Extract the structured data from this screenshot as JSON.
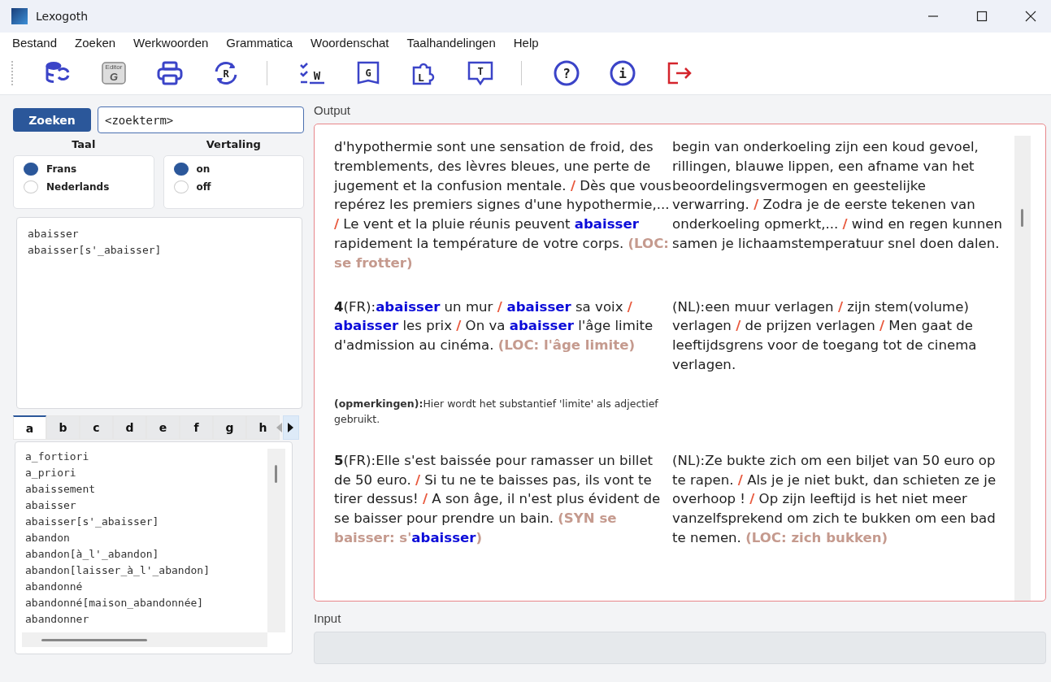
{
  "window": {
    "title": "Lexogoth"
  },
  "menu": [
    "Bestand",
    "Zoeken",
    "Werkwoorden",
    "Grammatica",
    "Woordenschat",
    "Taalhandelingen",
    "Help"
  ],
  "toolbar": [
    {
      "kind": "database-sync"
    },
    {
      "kind": "editor",
      "label": "Editor",
      "letter": "G"
    },
    {
      "kind": "printer"
    },
    {
      "kind": "refresh",
      "letter": "R"
    },
    {
      "kind": "separator"
    },
    {
      "kind": "checklist",
      "letter": "W"
    },
    {
      "kind": "book",
      "letter": "G"
    },
    {
      "kind": "puzzle",
      "letter": "L"
    },
    {
      "kind": "speech",
      "letter": "T"
    },
    {
      "kind": "separator"
    },
    {
      "kind": "circle",
      "letter": "?"
    },
    {
      "kind": "circle",
      "letter": "i"
    },
    {
      "kind": "exit"
    }
  ],
  "search": {
    "button": "Zoeken",
    "value": "<zoekterm>"
  },
  "taal": {
    "label": "Taal",
    "options": [
      {
        "label": "Frans",
        "selected": true
      },
      {
        "label": "Nederlands",
        "selected": false
      }
    ]
  },
  "vertaling": {
    "label": "Vertaling",
    "options": [
      {
        "label": "on",
        "selected": true
      },
      {
        "label": "off",
        "selected": false
      }
    ]
  },
  "results": [
    "abaisser",
    "abaisser[s'_abaisser]"
  ],
  "letter_tabs": [
    {
      "label": "a",
      "selected": true
    },
    {
      "label": "b",
      "selected": false
    },
    {
      "label": "c",
      "selected": false
    },
    {
      "label": "d",
      "selected": false
    },
    {
      "label": "e",
      "selected": false
    },
    {
      "label": "f",
      "selected": false
    },
    {
      "label": "g",
      "selected": false
    },
    {
      "label": "h",
      "selected": false
    }
  ],
  "word_list": [
    "a_fortiori",
    "a_priori",
    "abaissement",
    "abaisser",
    "abaisser[s'_abaisser]",
    "abandon",
    "abandon[à_l'_abandon]",
    "abandon[laisser_à_l'_abandon]",
    "abandonné",
    "abandonné[maison_abandonnée]",
    "abandonner"
  ],
  "output": {
    "label": "Output",
    "entries": [
      {
        "fr": [
          {
            "kind": "text",
            "text": "d'hypothermie sont une sensation de froid, des tremblements, des lèvres bleues, une perte de jugement et la confusion mentale. "
          },
          {
            "kind": "sep",
            "text": "/"
          },
          {
            "kind": "text",
            "text": " Dès que vous repérez les premiers signes d'une hypothermie,... "
          },
          {
            "kind": "sep",
            "text": "/"
          },
          {
            "kind": "text",
            "text": " Le vent et la pluie réunis peuvent "
          },
          {
            "kind": "hit",
            "text": "abaisser"
          },
          {
            "kind": "text",
            "text": " rapidement la température de votre corps. "
          },
          {
            "kind": "loc",
            "text": "(LOC: se frotter)"
          }
        ],
        "nl": [
          {
            "kind": "text",
            "text": "begin van onderkoeling zijn een koud gevoel, rillingen, blauwe lippen, een afname van het beoordelingsvermogen en geestelijke verwarring. "
          },
          {
            "kind": "sep",
            "text": "/"
          },
          {
            "kind": "text",
            "text": " Zodra je de eerste tekenen van onderkoeling opmerkt,... "
          },
          {
            "kind": "sep",
            "text": "/"
          },
          {
            "kind": "text",
            "text": " wind en regen kunnen samen je lichaamstemperatuur snel doen dalen."
          }
        ]
      },
      {
        "fr": [
          {
            "kind": "num",
            "text": "4"
          },
          {
            "kind": "text",
            "text": "(FR):"
          },
          {
            "kind": "hit",
            "text": "abaisser"
          },
          {
            "kind": "text",
            "text": " un mur "
          },
          {
            "kind": "sep",
            "text": "/ "
          },
          {
            "kind": "hit",
            "text": "abaisser"
          },
          {
            "kind": "text",
            "text": " sa voix "
          },
          {
            "kind": "sep",
            "text": "/ "
          },
          {
            "kind": "hit",
            "text": "abaisser"
          },
          {
            "kind": "text",
            "text": " les prix "
          },
          {
            "kind": "sep",
            "text": "/"
          },
          {
            "kind": "text",
            "text": " On va "
          },
          {
            "kind": "hit",
            "text": "abaisser"
          },
          {
            "kind": "text",
            "text": " l'âge limite d'admission au cinéma. "
          },
          {
            "kind": "loc",
            "text": "(LOC: l'âge limite)"
          }
        ],
        "nl": [
          {
            "kind": "text",
            "text": "(NL):een muur verlagen "
          },
          {
            "kind": "sep",
            "text": "/"
          },
          {
            "kind": "text",
            "text": " zijn stem(volume) verlagen "
          },
          {
            "kind": "sep",
            "text": "/"
          },
          {
            "kind": "text",
            "text": " de prijzen verlagen "
          },
          {
            "kind": "sep",
            "text": "/"
          },
          {
            "kind": "text",
            "text": " Men gaat de leeftijdsgrens voor de toegang tot de cinema verlagen."
          }
        ],
        "remark": "**(opmerkingen):**Hier wordt het substantief 'limite' als adjectief gebruikt."
      },
      {
        "fr": [
          {
            "kind": "num",
            "text": "5"
          },
          {
            "kind": "text",
            "text": "(FR):Elle s'est baissée pour ramasser un billet de 50 euro. "
          },
          {
            "kind": "sep",
            "text": "/"
          },
          {
            "kind": "text",
            "text": " Si tu ne te baisses pas, ils vont te tirer dessus! "
          },
          {
            "kind": "sep",
            "text": "/"
          },
          {
            "kind": "text",
            "text": " A son âge, il n'est plus évident de se baisser pour prendre un bain. "
          },
          {
            "kind": "loc",
            "text": "(SYN se baisser: s'"
          },
          {
            "kind": "hit",
            "text": "abaisser"
          },
          {
            "kind": "loc",
            "text": ")"
          }
        ],
        "nl": [
          {
            "kind": "text",
            "text": "(NL):Ze bukte zich om een biljet van 50 euro op te rapen. "
          },
          {
            "kind": "sep",
            "text": "/"
          },
          {
            "kind": "text",
            "text": " Als je je niet bukt, dan schieten ze je overhoop ! "
          },
          {
            "kind": "sep",
            "text": "/"
          },
          {
            "kind": "text",
            "text": " Op zijn leeftijd is het niet meer vanzelfsprekend om zich te bukken om een bad te nemen. "
          },
          {
            "kind": "loc",
            "text": "(LOC: zich bukken)"
          }
        ]
      }
    ]
  },
  "input": {
    "label": "Input"
  }
}
